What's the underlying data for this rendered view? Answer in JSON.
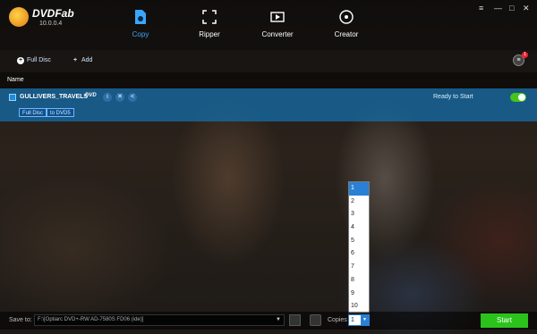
{
  "app": {
    "name": "DVDFab",
    "version": "10.0.0.4"
  },
  "tabs": [
    {
      "label": "Copy",
      "icon": "copy-disc-icon",
      "active": true
    },
    {
      "label": "Ripper",
      "icon": "ripper-icon",
      "active": false
    },
    {
      "label": "Converter",
      "icon": "converter-icon",
      "active": false
    },
    {
      "label": "Creator",
      "icon": "creator-icon",
      "active": false
    }
  ],
  "window_controls": {
    "menu": "≡",
    "minimize": "—",
    "maximize": "□",
    "close": "✕"
  },
  "toolbar": {
    "full_disc": "Full Disc",
    "add": "Add",
    "queue_count": "1"
  },
  "list": {
    "header": "Name",
    "items": [
      {
        "title": "GULLIVERS_TRAVELS",
        "format": "DVD",
        "status": "Ready to Start",
        "enabled": true,
        "tags": [
          "Full Disc",
          "to DVD5"
        ]
      }
    ]
  },
  "copies_dropdown": {
    "options": [
      "1",
      "2",
      "3",
      "4",
      "5",
      "6",
      "7",
      "8",
      "9",
      "10"
    ],
    "selected": "1"
  },
  "bottom": {
    "save_to_label": "Save to:",
    "save_to_value": "F:\\[Optiarc DVD+-RW AD-7580S FD06 (ide)]",
    "copies_label": "Copies",
    "copies_value": "1",
    "start_label": "Start"
  },
  "colors": {
    "accent": "#39a7ff",
    "row_highlight": "#146eaa",
    "start_green": "#2bc31b",
    "toggle_green": "#43c51b"
  }
}
